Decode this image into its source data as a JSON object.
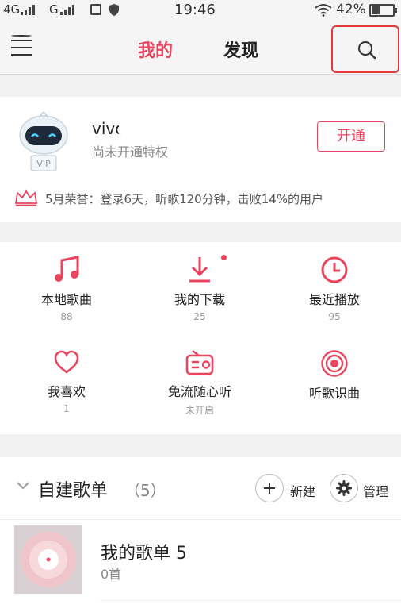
{
  "status_bar": {
    "net1": "4G",
    "net2": "G",
    "time": "19:46",
    "battery": "42%"
  },
  "header": {
    "tabs": [
      {
        "label": "我的",
        "active": true
      },
      {
        "label": "发现",
        "active": false
      }
    ],
    "accent_color": "#e8455f"
  },
  "profile": {
    "username": "vivo",
    "status": "尚未开通特权",
    "open_button": "开通",
    "honor_text": "5月荣誉：登录6天，听歌120分钟，击败14%的用户"
  },
  "grid": [
    {
      "label": "本地歌曲",
      "count": "88",
      "icon": "music-note-icon"
    },
    {
      "label": "我的下载",
      "count": "25",
      "icon": "download-icon"
    },
    {
      "label": "最近播放",
      "count": "95",
      "icon": "clock-icon"
    },
    {
      "label": "我喜欢",
      "count": "1",
      "icon": "heart-icon"
    },
    {
      "label": "免流随心听",
      "count": "未开启",
      "icon": "radio-icon"
    },
    {
      "label": "听歌识曲",
      "count": "",
      "icon": "recognize-icon"
    }
  ],
  "playlists": {
    "title": "自建歌单",
    "count": "（5）",
    "new_label": "新建",
    "manage_label": "管理",
    "items": [
      {
        "name": "我的歌单 5",
        "sub": "0首"
      }
    ]
  }
}
